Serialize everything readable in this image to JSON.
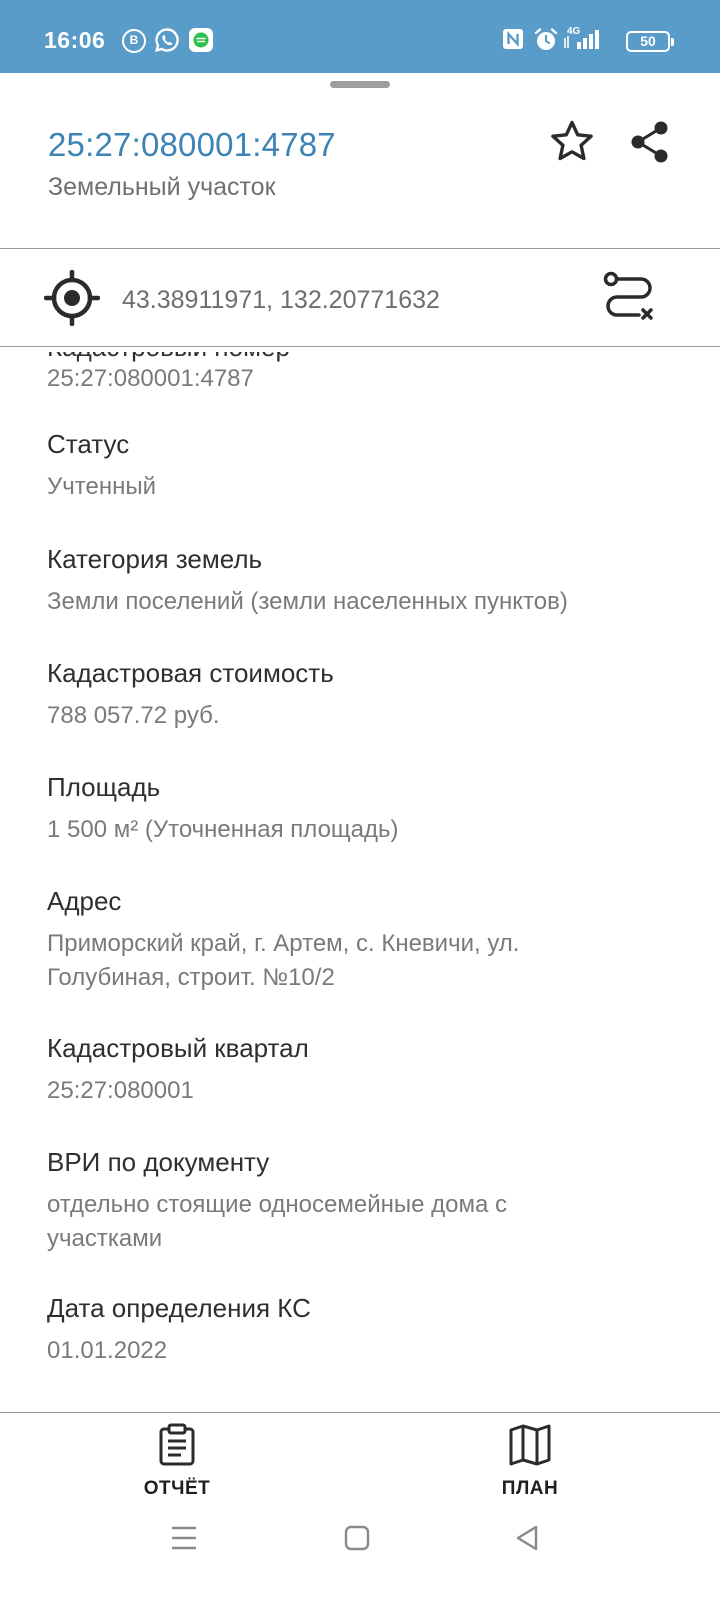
{
  "status_bar": {
    "time": "16:06",
    "notifications": [
      "b-circle-icon",
      "whatsapp-icon",
      "messenger-icon"
    ],
    "indicators": [
      "nfc-icon",
      "alarm-icon",
      "4g-signal-icon"
    ],
    "network": "4G",
    "battery": "50",
    "color": "#5a9cc9"
  },
  "header": {
    "title": "25:27:080001:4787",
    "subtitle": "Земельный участок",
    "title_color": "#3d84b4",
    "actions": [
      "star-icon",
      "share-icon"
    ]
  },
  "coordinates": {
    "text": "43.38911971, 132.20771632",
    "left_icon": "gps-target-icon",
    "right_icon": "route-clear-icon"
  },
  "details": {
    "partial_value": "25:27:080001:4787",
    "fields": [
      {
        "label": "Статус",
        "value": "Учтенный"
      },
      {
        "label": "Категория земель",
        "value": "Земли поселений (земли населенных пунктов)"
      },
      {
        "label": "Кадастровая стоимость",
        "value": "788 057.72 руб."
      },
      {
        "label": "Площадь",
        "value": "1 500 м² (Уточненная площадь)"
      },
      {
        "label": "Адрес",
        "value_line1": "Приморский край, г. Артем, с. Кневичи, ул.",
        "value_line2": "Голубиная, строит. №10/2"
      },
      {
        "label": "Кадастровый квартал",
        "value": "25:27:080001"
      },
      {
        "label": "ВРИ по документу",
        "value_line1": "отдельно стоящие односемейные дома с",
        "value_line2": "участками"
      },
      {
        "label": "Дата определения КС",
        "value": "01.01.2022"
      }
    ]
  },
  "bottom_nav": {
    "report_label": "ОТЧЁТ",
    "plan_label": "ПЛАН"
  },
  "system_nav": [
    "menu-icon",
    "home-icon",
    "back-icon"
  ]
}
